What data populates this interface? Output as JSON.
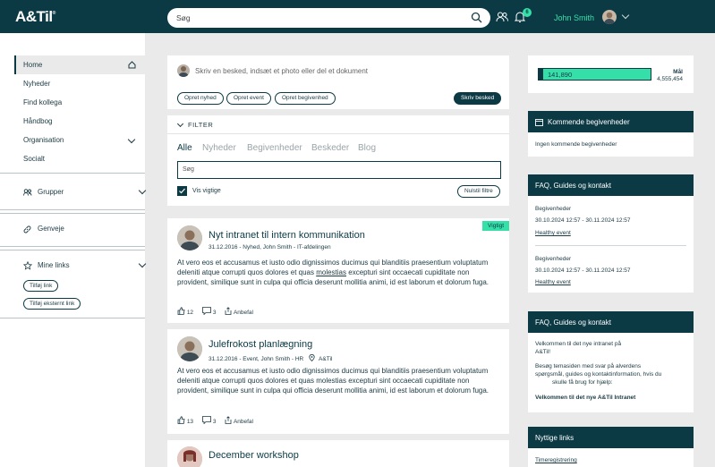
{
  "header": {
    "logo": "A&Til",
    "logo_mark": "®",
    "search_placeholder": "Søg",
    "notif_count": "6",
    "user_name": "John Smith"
  },
  "nav": {
    "items": [
      "Home",
      "Nyheder",
      "Find kollega",
      "Håndbog",
      "Organisation",
      "Socialt"
    ],
    "groups_label": "Grupper",
    "shortcuts_label": "Genveje",
    "links_label": "Mine links",
    "add_link": "Tilføj link",
    "add_ext_link": "Tilføj eksternt link"
  },
  "composer": {
    "placeholder": "Skriv en besked, indsæt et photo eller del et dokument",
    "btn_news": "Opret nyhed",
    "btn_event": "Opret event",
    "btn_happening": "Opret begivenhed",
    "btn_post": "Skriv besked"
  },
  "filter": {
    "label": "FILTER",
    "tabs": [
      "Alle",
      "Nyheder",
      "Begivenheder",
      "Beskeder",
      "Blog"
    ],
    "search_placeholder": "Søg",
    "checkbox_label": "Vis vigtige",
    "btn_filter": "Nulstil filtre"
  },
  "posts": [
    {
      "badge": "Vigtigt",
      "title": "Nyt intranet til intern kommunikation",
      "meta": "31.12.2016 - Nyhed, John Smith - IT-afdelingen",
      "body_1": "At vero eos et accusamus et iusto odio dignissimos ducimus qui blanditiis praesentium voluptatum deleniti atque corrupti quos dolores et quas ",
      "body_link": "molestias",
      "body_2": " excepturi sint occaecati cupiditate non provident, similique sunt in culpa qui officia deserunt mollitia animi, id est laborum et dolorum fuga.",
      "likes": "12",
      "comments": "3",
      "recommend": "Anbefal"
    },
    {
      "title": "Julefrokost planlægning",
      "meta": "31.12.2016 - Event, John Smith - HR",
      "location": "A&Til",
      "body": "At vero eos et accusamus et iusto odio dignissimos ducimus qui blanditiis praesentium voluptatum deleniti atque corrupti quos dolores et quas molestias excepturi sint occaecati cupiditate non provident, similique sunt in culpa qui officia deserunt mollitia animi, id est laborum et dolorum fuga.",
      "likes": "13",
      "comments": "3",
      "recommend": "Anbefal"
    },
    {
      "title": "December workshop"
    }
  ],
  "progress": {
    "value": "141,890",
    "goal_label": "Mål",
    "goal": "4,555,454",
    "fill_fraction": 1.0,
    "color": "#35e0a8"
  },
  "events": {
    "title": "Kommende begivenheder",
    "empty": "Ingen kommende begivenheder"
  },
  "faq1": {
    "title": "FAQ, Guides og kontakt",
    "items": [
      {
        "label": "Begivenheder",
        "date": "30.10.2024 12:57 - 30.11.2024 12:57",
        "link": "Healthy event"
      },
      {
        "label": "Begivenheder",
        "date": "30.10.2024 12:57 - 30.11.2024 12:57",
        "link": "Healthy event"
      }
    ]
  },
  "faq2": {
    "title": "FAQ, Guides og kontakt",
    "line1": "Velkommen til det nye intranet på",
    "line2": "A&Til!",
    "line3": "Besøg temasiden med svar på alverdens",
    "line4": "spørgsmål, guides og kontaktinformation, hvis du",
    "line5": "skulle få brug for hjælp:",
    "bold": "Velkommen til det nye A&Til Intranet"
  },
  "links": {
    "title": "Nyttige links",
    "item": "Timeregistrering"
  },
  "colors": {
    "brand": "#0b3a45",
    "accent": "#35e0a8"
  }
}
